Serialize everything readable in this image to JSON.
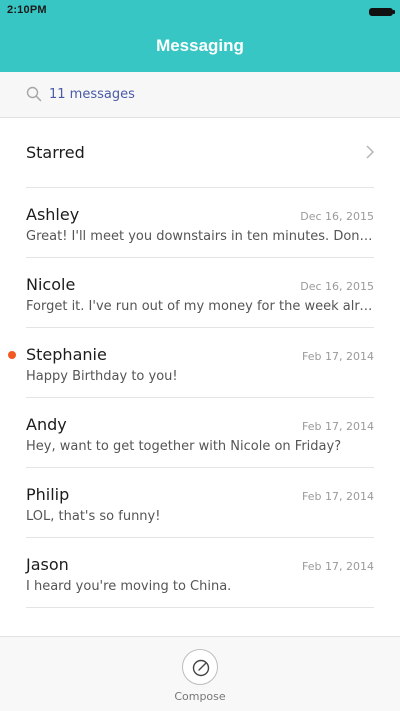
{
  "status_bar": {
    "time": "2:10PM"
  },
  "app": {
    "title": "Messaging"
  },
  "search": {
    "count_text": "11 messages"
  },
  "starred": {
    "label": "Starred"
  },
  "conversations": [
    {
      "name": "Ashley",
      "date": "Dec 16, 2015",
      "preview": "Great! I'll meet you downstairs in ten minutes. Don't forget",
      "unread": false
    },
    {
      "name": "Nicole",
      "date": "Dec 16, 2015",
      "preview": "Forget it. I've run out of my money for the week already.",
      "unread": false
    },
    {
      "name": "Stephanie",
      "date": "Feb 17, 2014",
      "preview": "Happy Birthday to you!",
      "unread": true
    },
    {
      "name": "Andy",
      "date": "Feb 17, 2014",
      "preview": "Hey, want to get together with Nicole on Friday?",
      "unread": false
    },
    {
      "name": "Philip",
      "date": "Feb 17, 2014",
      "preview": "LOL, that's so funny!",
      "unread": false
    },
    {
      "name": "Jason",
      "date": "Feb 17, 2014",
      "preview": "I heard you're moving to China.",
      "unread": false
    }
  ],
  "compose": {
    "label": "Compose"
  },
  "colors": {
    "header": "#37c6c4",
    "unread_dot": "#f15a22",
    "search_text": "#4a5aa8"
  }
}
